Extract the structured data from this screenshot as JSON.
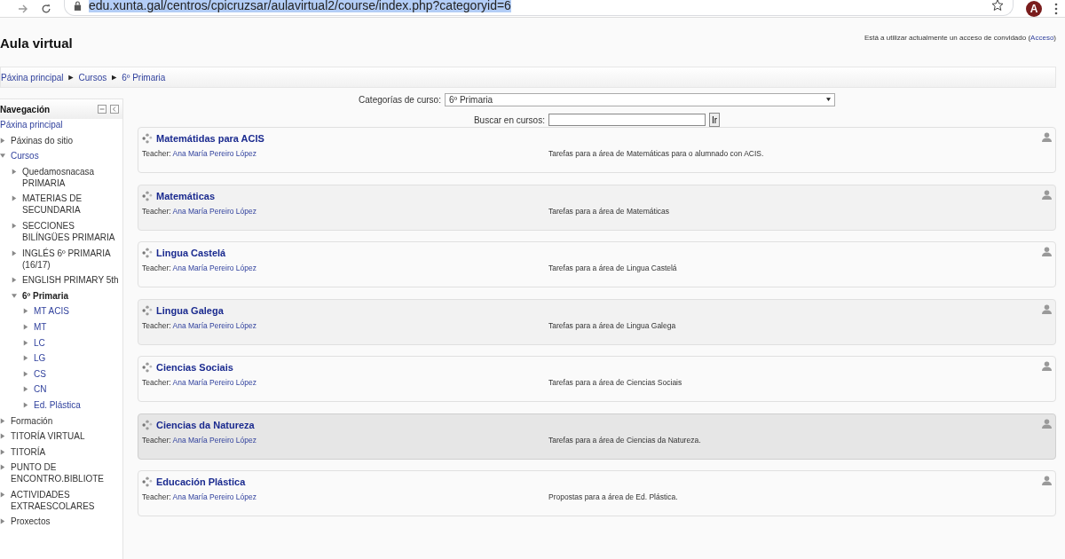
{
  "browser": {
    "url": "edu.xunta.gal/centros/cpicruzsar/aulavirtual2/course/index.php?categoryid=6",
    "url_selected": true,
    "profile_initial": "A"
  },
  "header": {
    "title": "Aula virtual",
    "guest_text": "Está a utilizar actualmente un acceso de convidado (",
    "login_link": "Acceso",
    "guest_text_end": ")"
  },
  "breadcrumb": [
    {
      "label": "Páxina principal"
    },
    {
      "label": "Cursos"
    },
    {
      "label": "6º Primaria"
    }
  ],
  "breadcrumb_separator": "►",
  "navigation": {
    "title": "Navegación",
    "items": [
      {
        "label": "Páxina principal",
        "kind": "home"
      },
      {
        "label": "Páxinas do sitio",
        "kind": "text",
        "expanded": false
      },
      {
        "label": "Cursos",
        "kind": "link",
        "expanded": true,
        "children": [
          {
            "label": "Quedamosnacasa PRIMARIA",
            "kind": "text",
            "expanded": false
          },
          {
            "label": "MATERIAS DE SECUNDARIA",
            "kind": "text",
            "expanded": false
          },
          {
            "label": "SECCIONES BILÍNGÜES PRIMARIA",
            "kind": "text",
            "expanded": false
          },
          {
            "label": "INGLÉS 6º PRIMARIA (16/17)",
            "kind": "text",
            "expanded": false
          },
          {
            "label": "ENGLISH PRIMARY 5th",
            "kind": "text",
            "expanded": false
          },
          {
            "label": "6º Primaria",
            "kind": "current",
            "expanded": true,
            "children": [
              {
                "label": "MT ACIS",
                "kind": "link",
                "expanded": false
              },
              {
                "label": "MT",
                "kind": "link",
                "expanded": false
              },
              {
                "label": "LC",
                "kind": "link",
                "expanded": false
              },
              {
                "label": "LG",
                "kind": "link",
                "expanded": false
              },
              {
                "label": "CS",
                "kind": "link",
                "expanded": false
              },
              {
                "label": "CN",
                "kind": "link",
                "expanded": false
              },
              {
                "label": "Ed. Plástica",
                "kind": "link",
                "expanded": false
              }
            ]
          }
        ]
      },
      {
        "label": "Formación",
        "kind": "text",
        "expanded": false
      },
      {
        "label": "TITORÍA VIRTUAL",
        "kind": "text",
        "expanded": false
      },
      {
        "label": "TITORÍA",
        "kind": "text",
        "expanded": false
      },
      {
        "label": "PUNTO DE ENCONTRO.BIBLIOTE",
        "kind": "text",
        "expanded": false
      },
      {
        "label": "ACTIVIDADES EXTRAESCOLARES",
        "kind": "text",
        "expanded": false
      },
      {
        "label": "Proxectos",
        "kind": "text",
        "expanded": false
      }
    ]
  },
  "category_select": {
    "label": "Categorías de curso:",
    "value": "6º Primaria"
  },
  "course_search": {
    "label": "Buscar en cursos:",
    "button": "Ir"
  },
  "courses": [
    {
      "name": "Matemátidas para ACIS",
      "teacher_label": "Teacher:",
      "teacher": "Ana María Pereiro López",
      "summary": "Tarefas para a área de Matemáticas para o alumnado con ACIS.",
      "hovered": false
    },
    {
      "name": "Matemáticas",
      "teacher_label": "Teacher:",
      "teacher": "Ana María Pereiro López",
      "summary": "Tarefas para a área de Matemáticas",
      "hovered": false
    },
    {
      "name": "Lingua Castelá",
      "teacher_label": "Teacher:",
      "teacher": "Ana María Pereiro López",
      "summary": "Tarefas para a área de Lingua Castelá",
      "hovered": false
    },
    {
      "name": "Lingua Galega",
      "teacher_label": "Teacher:",
      "teacher": "Ana María Pereiro López",
      "summary": "Tarefas para a área de Lingua Galega",
      "hovered": false
    },
    {
      "name": "Ciencias Sociais",
      "teacher_label": "Teacher:",
      "teacher": "Ana María Pereiro López",
      "summary": "Tarefas para a área de Ciencias Sociais",
      "hovered": false
    },
    {
      "name": "Ciencias da Natureza",
      "teacher_label": "Teacher:",
      "teacher": "Ana María Pereiro López",
      "summary": "Tarefas para a área de Ciencias da Natureza.",
      "hovered": true
    },
    {
      "name": "Educación Plástica",
      "teacher_label": "Teacher:",
      "teacher": "Ana María Pereiro López",
      "summary": "Propostas para a área de Ed. Plástica.",
      "hovered": false
    }
  ]
}
